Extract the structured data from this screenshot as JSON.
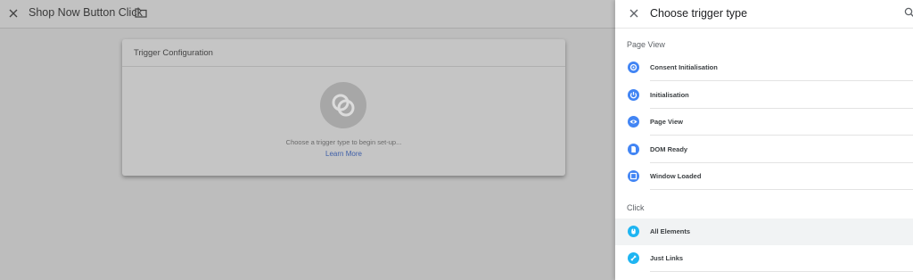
{
  "header": {
    "title": "Shop Now Button Click"
  },
  "card": {
    "heading": "Trigger Configuration",
    "hint": "Choose a trigger type to begin set-up...",
    "learn_more": "Learn More"
  },
  "panel": {
    "title": "Choose trigger type",
    "sections": [
      {
        "label": "Page View",
        "items": [
          {
            "label": "Consent Initialisation",
            "icon": "consent-icon"
          },
          {
            "label": "Initialisation",
            "icon": "power-icon"
          },
          {
            "label": "Page View",
            "icon": "eye-icon"
          },
          {
            "label": "DOM Ready",
            "icon": "document-icon"
          },
          {
            "label": "Window Loaded",
            "icon": "window-icon"
          }
        ]
      },
      {
        "label": "Click",
        "items": [
          {
            "label": "All Elements",
            "icon": "cursor-icon"
          },
          {
            "label": "Just Links",
            "icon": "link-icon"
          }
        ]
      }
    ]
  },
  "colors": {
    "pageview_icon": "#4285f4",
    "click_icon": "#1eb5f2",
    "selected_row": "#f1f3f4"
  }
}
